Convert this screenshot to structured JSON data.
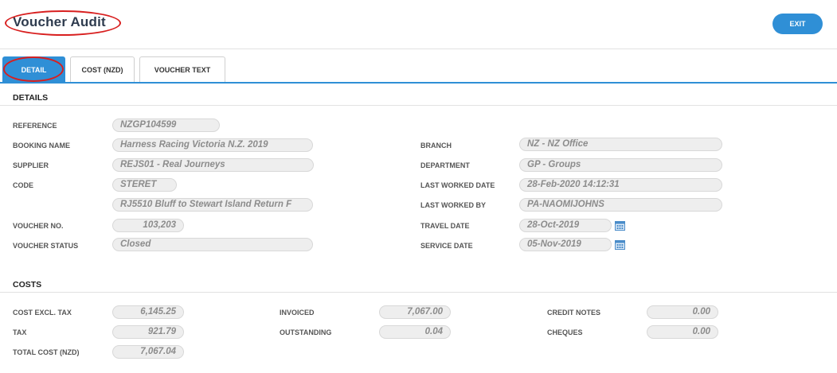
{
  "header": {
    "title": "Voucher Audit",
    "exit_label": "EXIT"
  },
  "tabs": [
    {
      "label": "DETAIL",
      "active": true
    },
    {
      "label": "COST (NZD)",
      "active": false
    },
    {
      "label": "VOUCHER TEXT",
      "active": false
    }
  ],
  "details": {
    "heading": "DETAILS",
    "reference": {
      "label": "REFERENCE",
      "value": "NZGP104599"
    },
    "booking_name": {
      "label": "BOOKING NAME",
      "value": "Harness Racing Victoria N.Z. 2019"
    },
    "supplier": {
      "label": "SUPPLIER",
      "value": "REJS01 - Real Journeys"
    },
    "code": {
      "label": "CODE",
      "value": "STERET",
      "description": "RJ5510 Bluff to Stewart Island Return F"
    },
    "voucher_no": {
      "label": "VOUCHER NO.",
      "value": "103,203"
    },
    "voucher_status": {
      "label": "VOUCHER STATUS",
      "value": "Closed"
    },
    "branch": {
      "label": "BRANCH",
      "value": "NZ - NZ Office"
    },
    "department": {
      "label": "DEPARTMENT",
      "value": "GP - Groups"
    },
    "last_worked_date": {
      "label": "LAST WORKED DATE",
      "value": "28-Feb-2020 14:12:31"
    },
    "last_worked_by": {
      "label": "LAST WORKED BY",
      "value": "PA-NAOMIJOHNS"
    },
    "travel_date": {
      "label": "TRAVEL DATE",
      "value": "28-Oct-2019"
    },
    "service_date": {
      "label": "SERVICE DATE",
      "value": "05-Nov-2019"
    }
  },
  "costs": {
    "heading": "COSTS",
    "cost_excl_tax": {
      "label": "COST EXCL. TAX",
      "value": "6,145.25"
    },
    "tax": {
      "label": "TAX",
      "value": "921.79"
    },
    "total_cost": {
      "label": "TOTAL COST (NZD)",
      "value": "7,067.04"
    },
    "invoiced": {
      "label": "INVOICED",
      "value": "7,067.00"
    },
    "outstanding": {
      "label": "OUTSTANDING",
      "value": "0.04"
    },
    "credit_notes": {
      "label": "CREDIT NOTES",
      "value": "0.00"
    },
    "cheques": {
      "label": "CHEQUES",
      "value": "0.00"
    }
  },
  "colors": {
    "accent": "#2f8fd6",
    "annotation": "#d81f1f"
  },
  "icons": {
    "calendar": "calendar-icon"
  }
}
